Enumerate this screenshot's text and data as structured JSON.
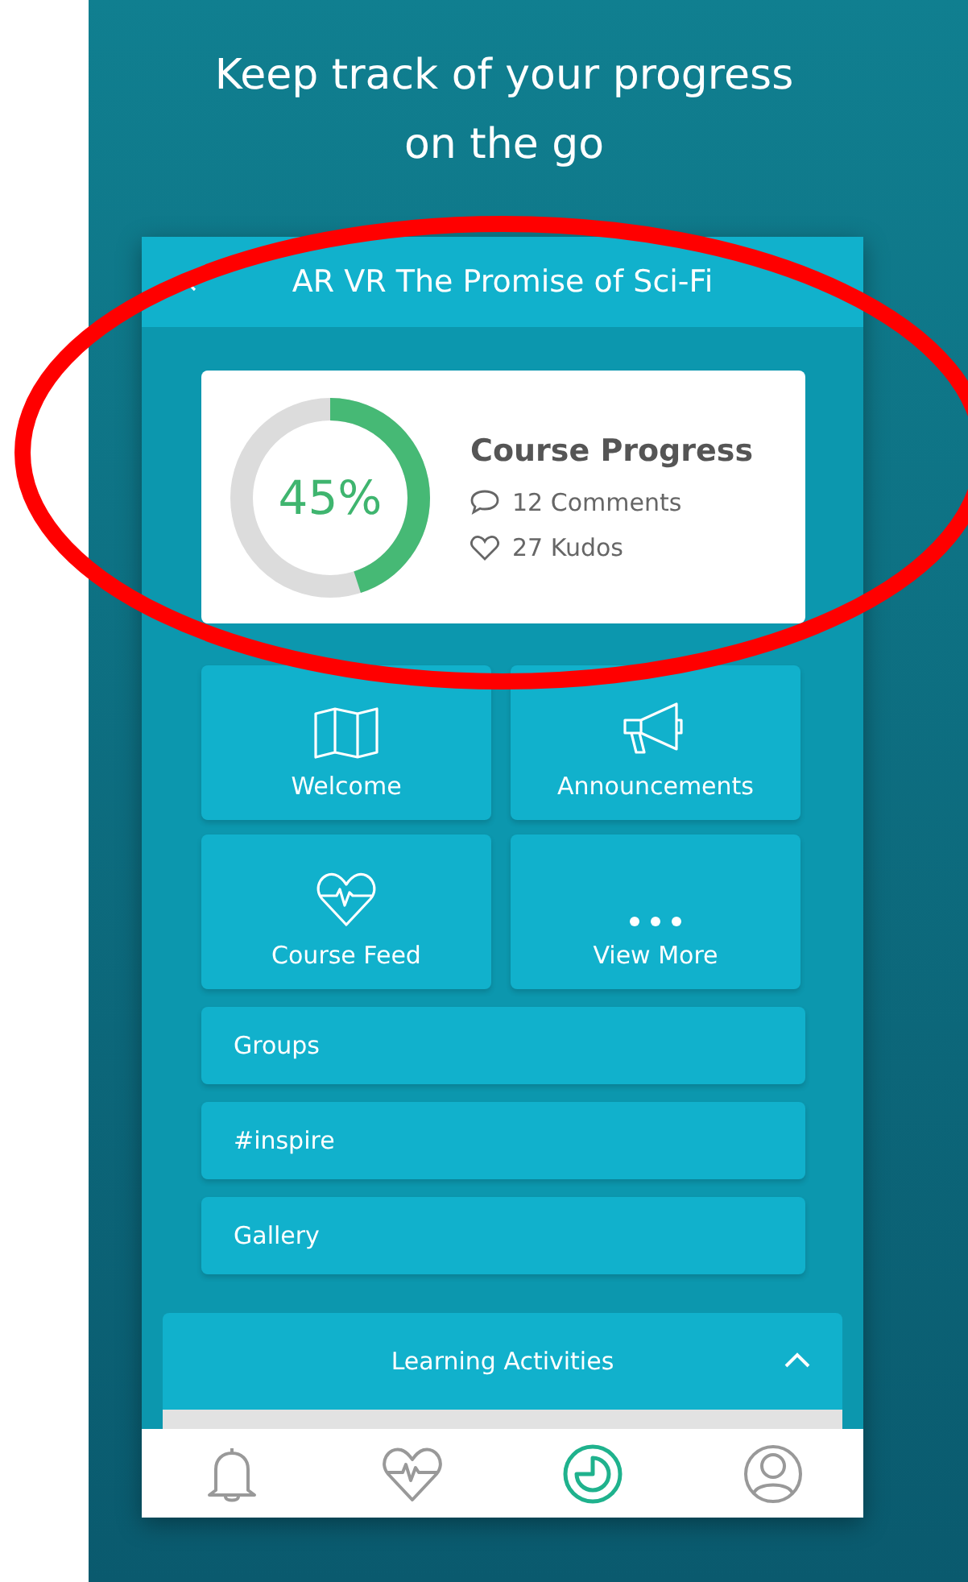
{
  "headline": "Keep track of your progress on the go",
  "course": {
    "title": "AR VR The Promise of Sci-Fi"
  },
  "progress": {
    "label": "45%",
    "title": "Course Progress",
    "comments": "12 Comments",
    "kudos": "27 Kudos"
  },
  "tiles": [
    {
      "kind": "map",
      "label": "Welcome"
    },
    {
      "kind": "megaphone",
      "label": "Announcements"
    },
    {
      "kind": "heart",
      "label": "Course Feed"
    },
    {
      "kind": "dots",
      "label": "View More"
    }
  ],
  "links": [
    "Groups",
    "#inspire",
    "Gallery"
  ],
  "accordion": {
    "title": "Learning Activities",
    "expanded": true
  },
  "nav": [
    {
      "kind": "bell",
      "selected": false
    },
    {
      "kind": "heart",
      "selected": false
    },
    {
      "kind": "progress",
      "selected": true
    },
    {
      "kind": "profile",
      "selected": false
    }
  ],
  "highlight": {
    "color": "#ff0000"
  }
}
